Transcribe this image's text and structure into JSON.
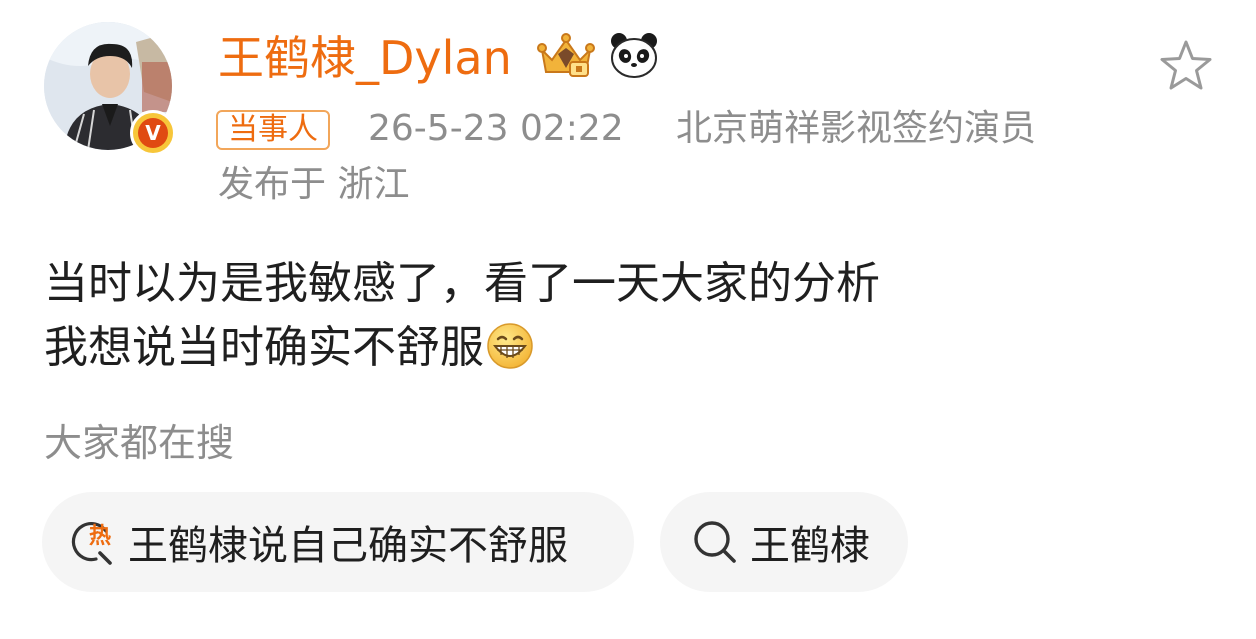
{
  "post": {
    "author": {
      "name": "王鹤棣_Dylan",
      "verified_badge": "V",
      "icons": [
        "crown-vip-icon",
        "panda-icon"
      ]
    },
    "tag": "当事人",
    "timestamp": "26-5-23 02:22",
    "source": "北京萌祥影视签约演员",
    "location": "发布于 浙江",
    "content_lines": [
      "当时以为是我敏感了，看了一天大家的分析",
      "我想说当时确实不舒服"
    ],
    "content_emoji": "grinning-face-emoji"
  },
  "search": {
    "heading": "大家都在搜",
    "chips": [
      {
        "label": "王鹤棣说自己确实不舒服",
        "icon": "hot-search-icon"
      },
      {
        "label": "王鹤棣",
        "icon": "search-icon"
      }
    ]
  },
  "colors": {
    "brand_orange": "#ee6c10",
    "muted_gray": "#8d8d8d",
    "text_dark": "#1f1f1f",
    "chip_background": "#f5f5f5"
  }
}
